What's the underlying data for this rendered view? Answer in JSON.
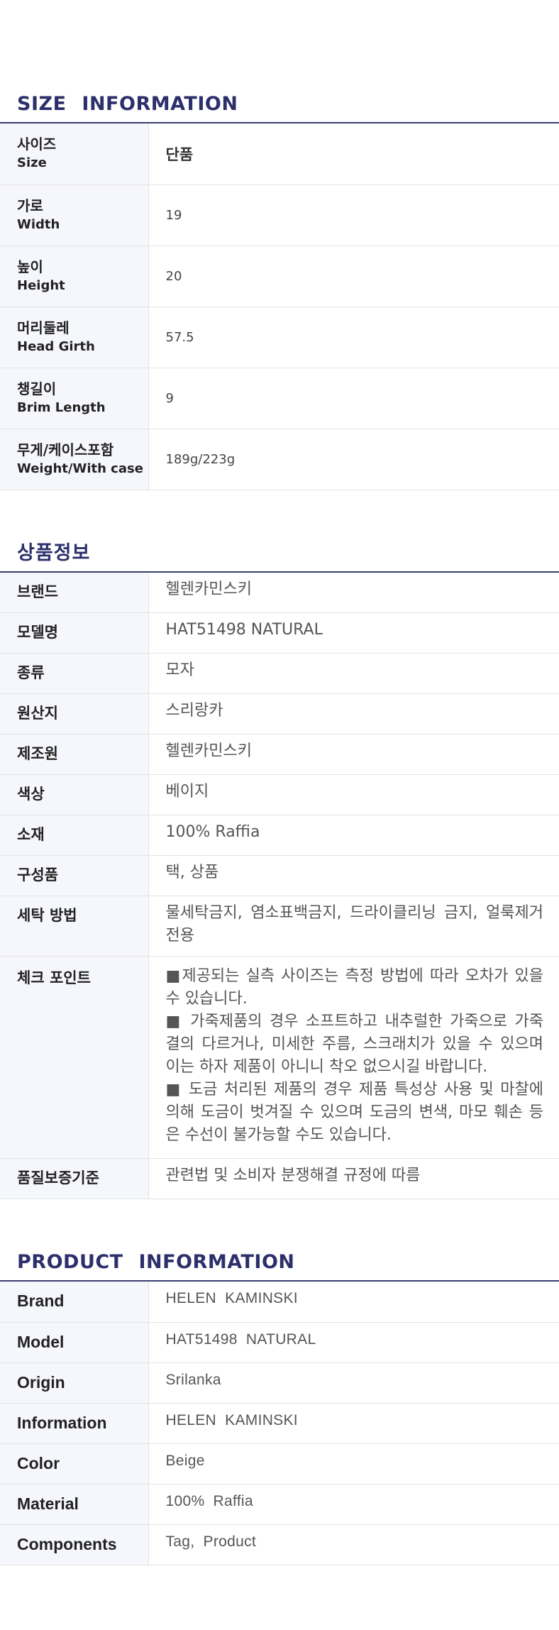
{
  "size_info": {
    "title": "SIZE   INFORMATION",
    "rows": [
      {
        "kr": "사이즈",
        "en": "Size",
        "value": "단품"
      },
      {
        "kr": "가로",
        "en": "Width",
        "value": "19"
      },
      {
        "kr": "높이",
        "en": "Height",
        "value": "20"
      },
      {
        "kr": "머리둘레",
        "en": "Head Girth",
        "value": "57.5"
      },
      {
        "kr": "챙길이",
        "en": "Brim Length",
        "value": "9"
      },
      {
        "kr": "무게/케이스포함",
        "en": "Weight/With case",
        "value": "189g/223g"
      }
    ]
  },
  "product_info_kr": {
    "title": "상품정보",
    "rows": [
      {
        "label": "브랜드",
        "value": "헬렌카민스키"
      },
      {
        "label": "모델명",
        "value": "HAT51498  NATURAL"
      },
      {
        "label": "종류",
        "value": "모자"
      },
      {
        "label": "원산지",
        "value": "스리랑카"
      },
      {
        "label": "제조원",
        "value": "헬렌카민스키"
      },
      {
        "label": "색상",
        "value": "베이지"
      },
      {
        "label": "소재",
        "value": "100%  Raffia"
      },
      {
        "label": "구성품",
        "value": "택, 상품"
      },
      {
        "label": "세탁 방법",
        "value": "물세탁금지, 염소표백금지, 드라이클리닝 금지, 얼룩제거 전용"
      }
    ],
    "check_point": {
      "label": "체크 포인트",
      "notes": [
        "■제공되는 실측 사이즈는 측정 방법에 따라 오차가 있을 수 있습니다.",
        "■ 가죽제품의 경우 소프트하고 내추럴한 가죽으로 가죽 결의 다르거나, 미세한 주름, 스크래치가 있을 수 있으며 이는 하자 제품이 아니니 착오 없으시길 바랍니다.",
        "■ 도금 처리된 제품의 경우 제품 특성상 사용 및 마찰에 의해 도금이 벗겨질 수 있으며 도금의 변색, 마모 훼손 등은 수선이 불가능할 수도 있습니다."
      ]
    },
    "quality": {
      "label": "품질보증기준",
      "value": "관련법 및 소비자 분쟁해결 규정에 따름"
    }
  },
  "product_info_en": {
    "title": "PRODUCT   INFORMATION",
    "rows": [
      {
        "label": "Brand",
        "value": "HELEN  KAMINSKI"
      },
      {
        "label": "Model",
        "value": "HAT51498  NATURAL"
      },
      {
        "label": "Origin",
        "value": "Srilanka"
      },
      {
        "label": "Information",
        "value": "HELEN  KAMINSKI"
      },
      {
        "label": "Color",
        "value": "Beige"
      },
      {
        "label": "Material",
        "value": "100%  Raffia"
      },
      {
        "label": "Components",
        "value": "Tag, Product"
      }
    ]
  }
}
